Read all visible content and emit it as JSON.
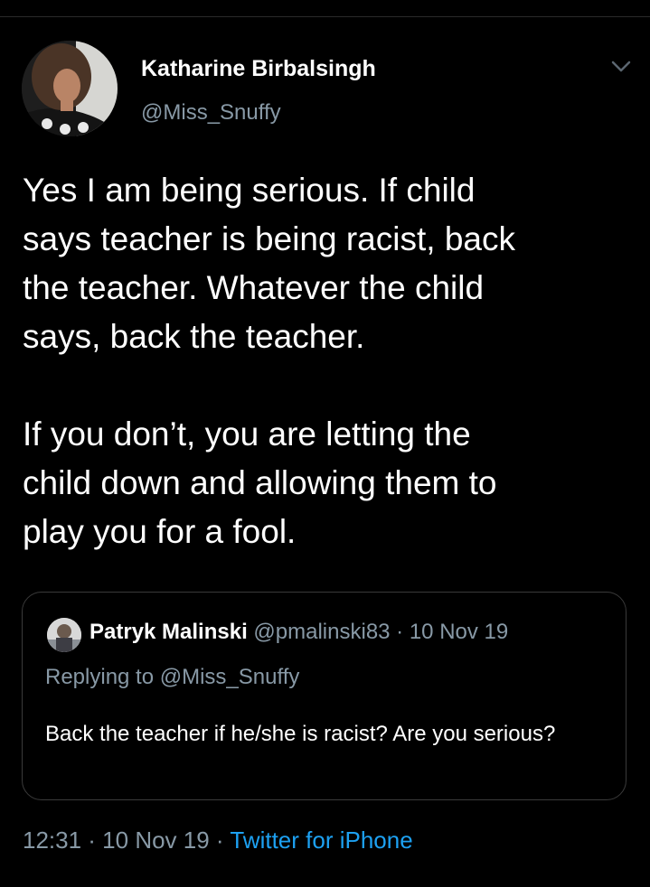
{
  "author": {
    "name": "Katharine Birbalsingh",
    "handle": "@Miss_Snuffy"
  },
  "tweet": {
    "paragraphs": [
      "Yes I am being serious. If child\nsays teacher is being racist, back\nthe teacher. Whatever the child\nsays, back the teacher.",
      "If you don’t, you are letting the\nchild down and allowing them to\nplay you for a fool."
    ]
  },
  "quote": {
    "name": "Patryk Malinski",
    "meta": " @pmalinski83 · 10 Nov 19",
    "replying": "Replying to @Miss_Snuffy",
    "text": "Back the teacher if he/she is racist? Are you serious?"
  },
  "footer": {
    "time": "12:31 · 10 Nov 19",
    "separator": " · ",
    "source": "Twitter for iPhone"
  },
  "icons": {
    "more": "chevron-down-icon"
  },
  "colors": {
    "background": "#000000",
    "primary_text": "#ffffff",
    "secondary_text": "#8899a6",
    "link": "#1da1f2",
    "border": "#3a3a3a"
  }
}
